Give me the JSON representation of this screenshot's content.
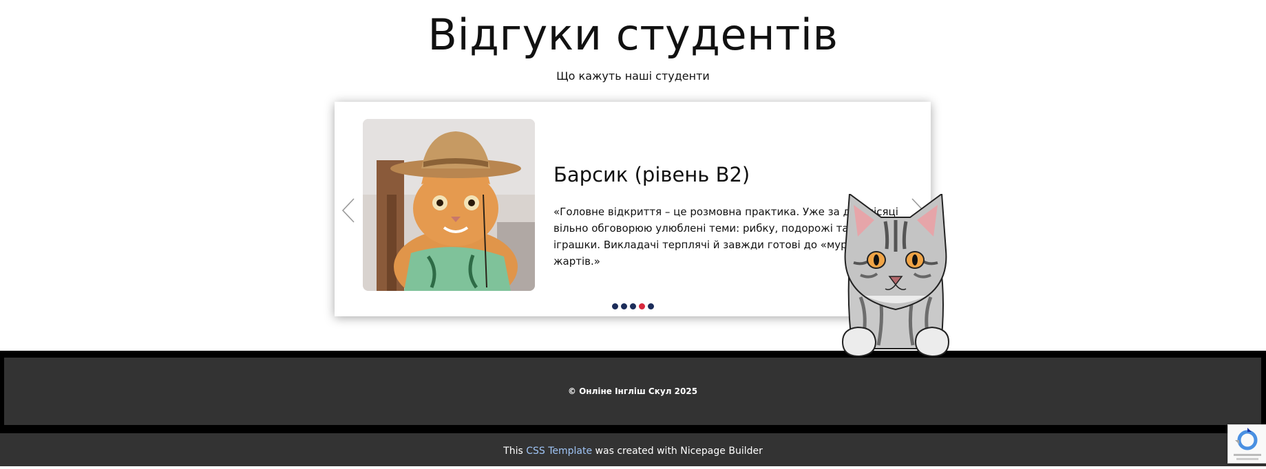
{
  "section": {
    "title": "Відгуки студентів",
    "subtitle": "Що кажуть наші студенти"
  },
  "testimonial": {
    "name": "Барсик (рівень B2)",
    "quote": "«Головне відкриття – це розмовна практика. Уже за два місяці вільно обговорюю улюблені теми: рибку, подорожі та нові іграшки. Викладачі терплячі й завжди готові до «мурkливих» жартів.»",
    "dots_total": 5,
    "active_dot": 4
  },
  "footer": {
    "copyright": "© Онліне Інгліш Скул 2025"
  },
  "builder": {
    "prefix": "This",
    "link_label": "CSS Template",
    "suffix": "was created with Nicepage Builder"
  },
  "colors": {
    "dot": "#1c2d5a",
    "dot_active": "#d8293e",
    "footer_bg": "#333333",
    "link": "#9fc4f5"
  },
  "icons": [
    "chevron-left-icon",
    "chevron-right-icon",
    "recaptcha-icon"
  ]
}
